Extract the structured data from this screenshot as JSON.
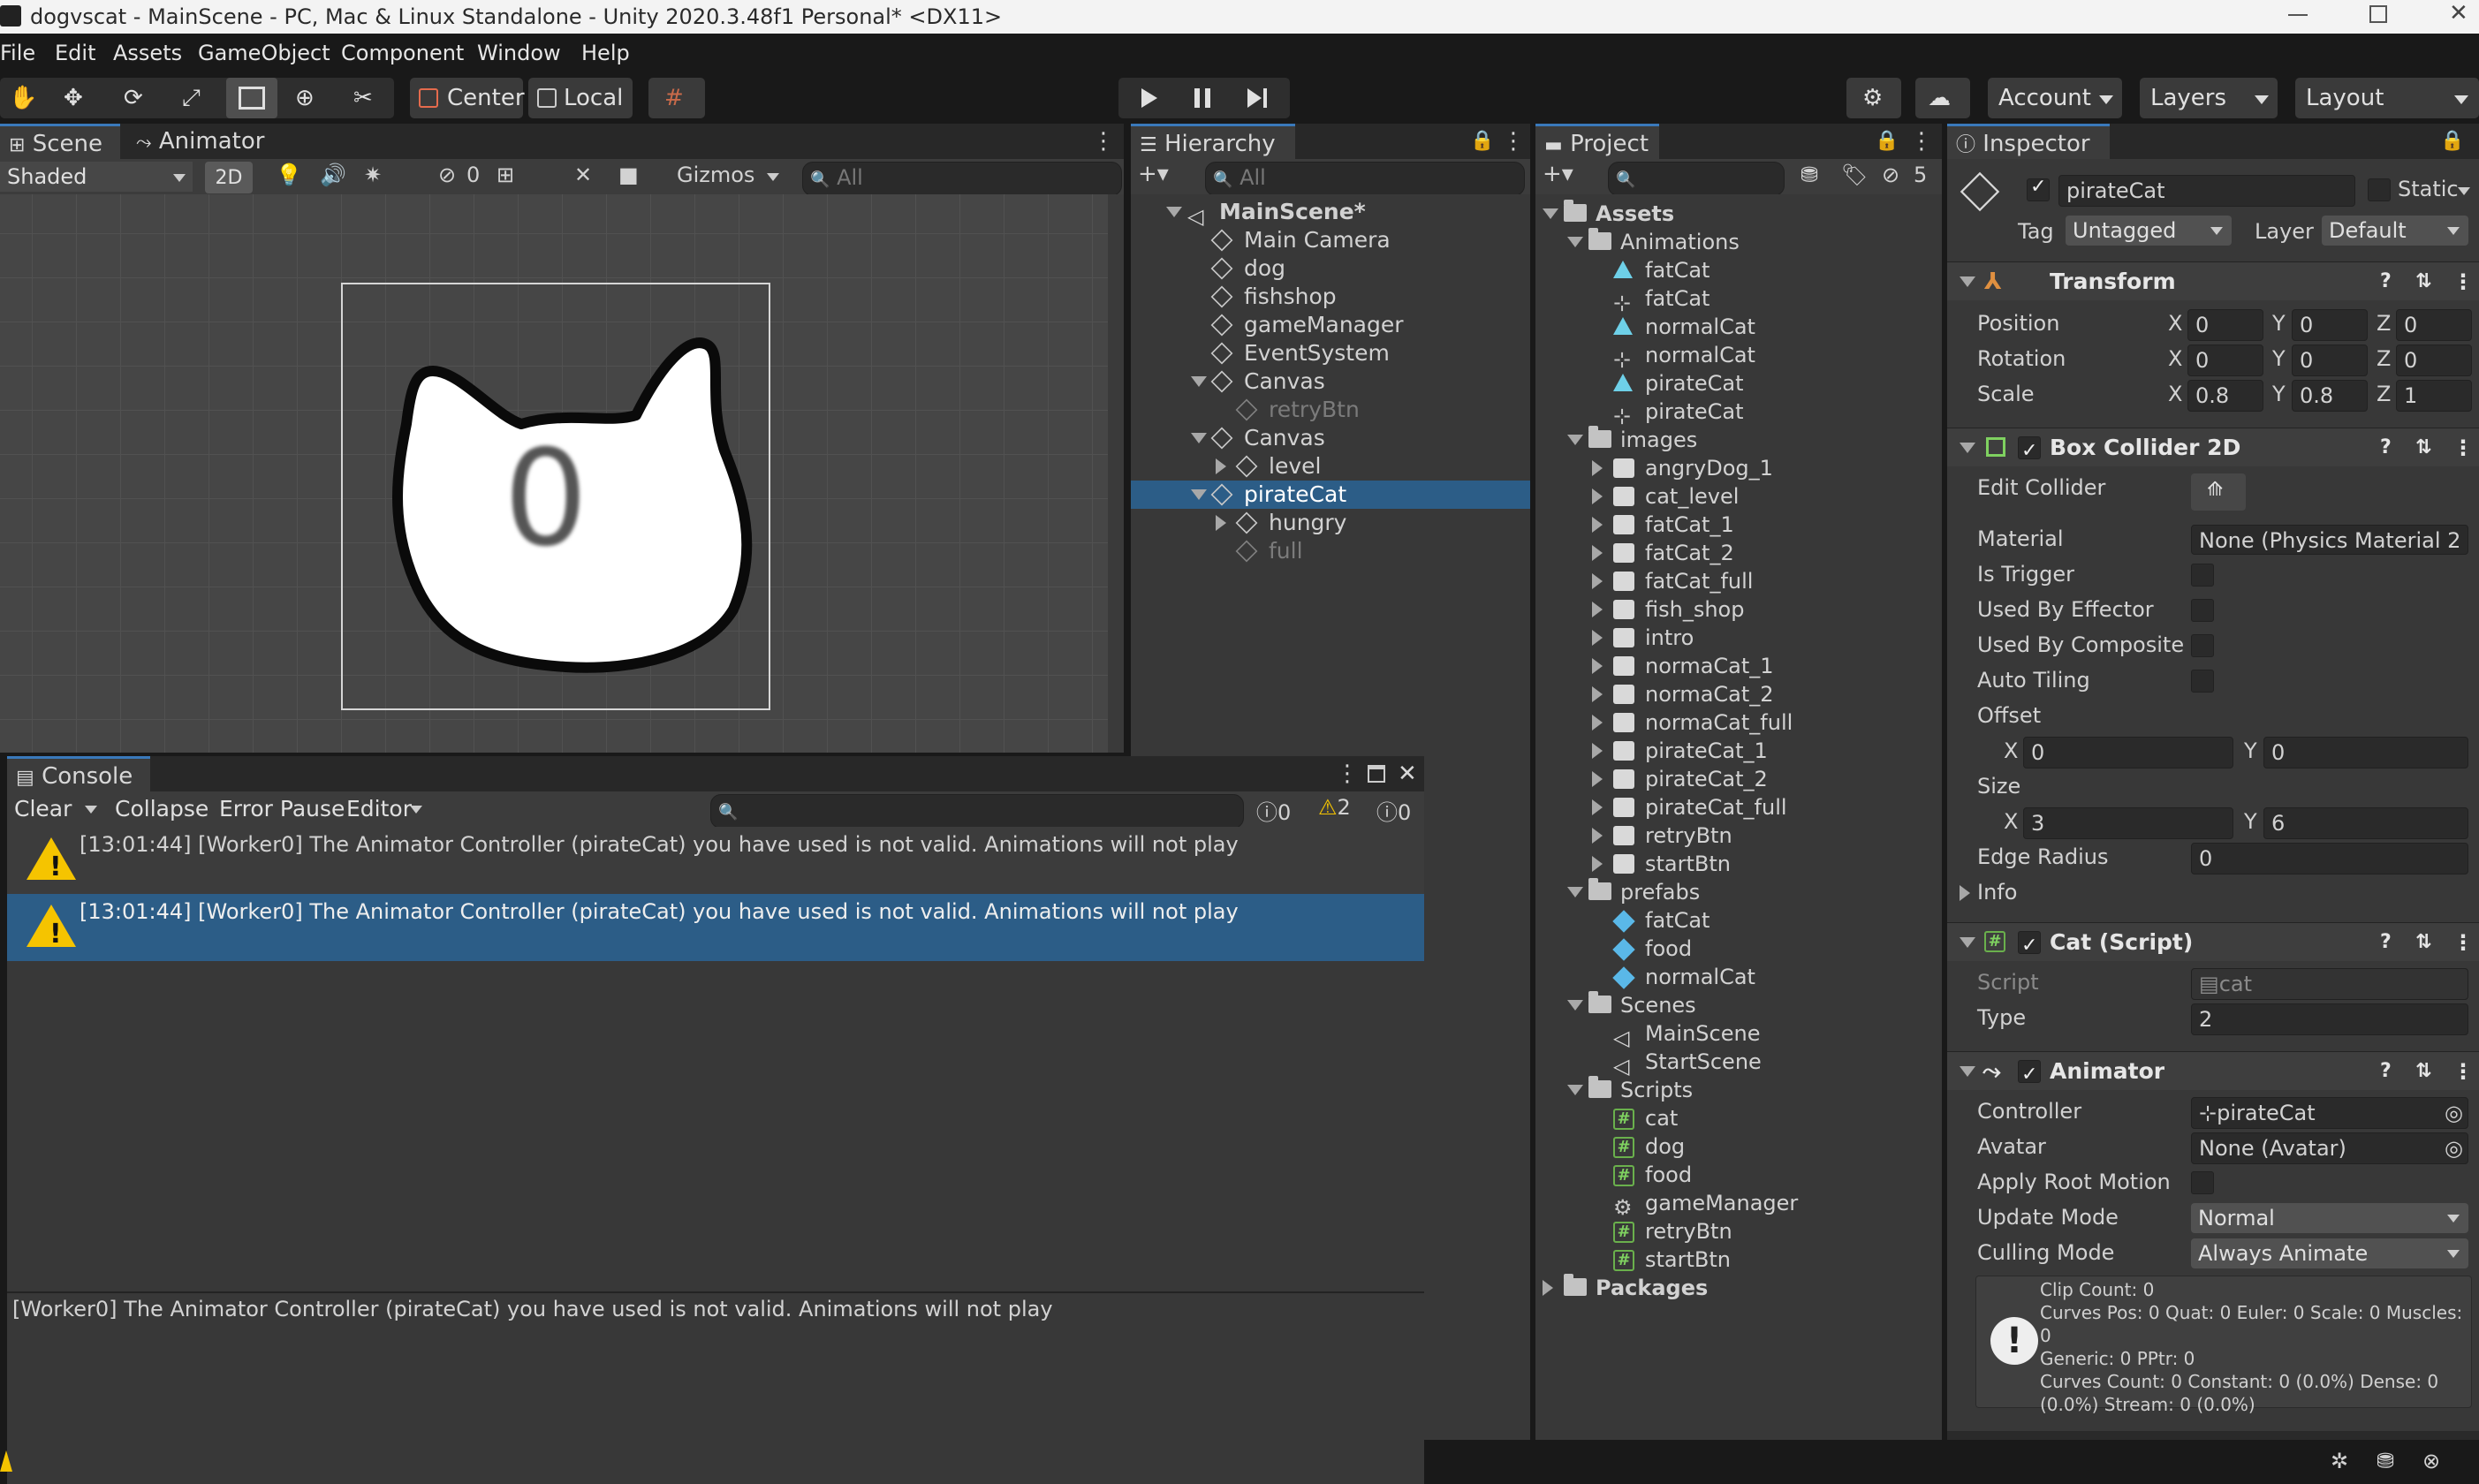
{
  "window": {
    "title": "dogvscat - MainScene - PC, Mac & Linux Standalone - Unity 2020.3.48f1 Personal* <DX11>"
  },
  "menu": [
    "File",
    "Edit",
    "Assets",
    "GameObject",
    "Component",
    "Window",
    "Help"
  ],
  "toolbar": {
    "center": "Center",
    "local": "Local",
    "account": "Account",
    "layers": "Layers",
    "layout": "Layout"
  },
  "scene": {
    "tab_scene": "Scene",
    "tab_animator": "Animator",
    "shading": "Shaded",
    "mode_2d": "2D",
    "hidden_count": "0",
    "gizmos": "Gizmos",
    "search_placeholder": "All",
    "cat_number": "0"
  },
  "hierarchy": {
    "tab": "Hierarchy",
    "search_placeholder": "All",
    "rows": [
      {
        "label": "MainScene*",
        "indent": 0,
        "icon": "scene",
        "expand": "open",
        "bold": true
      },
      {
        "label": "Main Camera",
        "indent": 1,
        "icon": "cube"
      },
      {
        "label": "dog",
        "indent": 1,
        "icon": "cube"
      },
      {
        "label": "fishshop",
        "indent": 1,
        "icon": "cube"
      },
      {
        "label": "gameManager",
        "indent": 1,
        "icon": "cube"
      },
      {
        "label": "EventSystem",
        "indent": 1,
        "icon": "cube"
      },
      {
        "label": "Canvas",
        "indent": 1,
        "icon": "cube",
        "expand": "open"
      },
      {
        "label": "retryBtn",
        "indent": 2,
        "icon": "cube",
        "dim": true
      },
      {
        "label": "Canvas",
        "indent": 1,
        "icon": "cube",
        "expand": "open"
      },
      {
        "label": "level",
        "indent": 2,
        "icon": "cube",
        "expand": "closed"
      },
      {
        "label": "pirateCat",
        "indent": 1,
        "icon": "cube",
        "expand": "open",
        "selected": true
      },
      {
        "label": "hungry",
        "indent": 2,
        "icon": "cube",
        "expand": "closed"
      },
      {
        "label": "full",
        "indent": 2,
        "icon": "cube",
        "dim": true
      }
    ]
  },
  "project": {
    "tab": "Project",
    "hidden_count": "5",
    "rows": [
      {
        "label": "Assets",
        "indent": 0,
        "icon": "folder",
        "expand": "open",
        "bold": true
      },
      {
        "label": "Animations",
        "indent": 1,
        "icon": "folder",
        "expand": "open"
      },
      {
        "label": "fatCat",
        "indent": 2,
        "icon": "anim"
      },
      {
        "label": "fatCat",
        "indent": 2,
        "icon": "ctrl"
      },
      {
        "label": "normalCat",
        "indent": 2,
        "icon": "anim"
      },
      {
        "label": "normalCat",
        "indent": 2,
        "icon": "ctrl"
      },
      {
        "label": "pirateCat",
        "indent": 2,
        "icon": "anim"
      },
      {
        "label": "pirateCat",
        "indent": 2,
        "icon": "ctrl"
      },
      {
        "label": "images",
        "indent": 1,
        "icon": "folder",
        "expand": "open"
      },
      {
        "label": "angryDog_1",
        "indent": 2,
        "icon": "img",
        "expand": "closed"
      },
      {
        "label": "cat_level",
        "indent": 2,
        "icon": "img",
        "expand": "closed"
      },
      {
        "label": "fatCat_1",
        "indent": 2,
        "icon": "img",
        "expand": "closed"
      },
      {
        "label": "fatCat_2",
        "indent": 2,
        "icon": "img",
        "expand": "closed"
      },
      {
        "label": "fatCat_full",
        "indent": 2,
        "icon": "img",
        "expand": "closed"
      },
      {
        "label": "fish_shop",
        "indent": 2,
        "icon": "img",
        "expand": "closed"
      },
      {
        "label": "intro",
        "indent": 2,
        "icon": "img",
        "expand": "closed"
      },
      {
        "label": "normaCat_1",
        "indent": 2,
        "icon": "img",
        "expand": "closed"
      },
      {
        "label": "normaCat_2",
        "indent": 2,
        "icon": "img",
        "expand": "closed"
      },
      {
        "label": "normaCat_full",
        "indent": 2,
        "icon": "img",
        "expand": "closed"
      },
      {
        "label": "pirateCat_1",
        "indent": 2,
        "icon": "img",
        "expand": "closed"
      },
      {
        "label": "pirateCat_2",
        "indent": 2,
        "icon": "img",
        "expand": "closed"
      },
      {
        "label": "pirateCat_full",
        "indent": 2,
        "icon": "img",
        "expand": "closed"
      },
      {
        "label": "retryBtn",
        "indent": 2,
        "icon": "img",
        "expand": "closed"
      },
      {
        "label": "startBtn",
        "indent": 2,
        "icon": "img",
        "expand": "closed"
      },
      {
        "label": "prefabs",
        "indent": 1,
        "icon": "folder",
        "expand": "open"
      },
      {
        "label": "fatCat",
        "indent": 2,
        "icon": "prefab"
      },
      {
        "label": "food",
        "indent": 2,
        "icon": "prefab"
      },
      {
        "label": "normalCat",
        "indent": 2,
        "icon": "prefab"
      },
      {
        "label": "Scenes",
        "indent": 1,
        "icon": "folder",
        "expand": "open"
      },
      {
        "label": "MainScene",
        "indent": 2,
        "icon": "scene"
      },
      {
        "label": "StartScene",
        "indent": 2,
        "icon": "scene"
      },
      {
        "label": "Scripts",
        "indent": 1,
        "icon": "folder",
        "expand": "open"
      },
      {
        "label": "cat",
        "indent": 2,
        "icon": "script"
      },
      {
        "label": "dog",
        "indent": 2,
        "icon": "script"
      },
      {
        "label": "food",
        "indent": 2,
        "icon": "script"
      },
      {
        "label": "gameManager",
        "indent": 2,
        "icon": "gear"
      },
      {
        "label": "retryBtn",
        "indent": 2,
        "icon": "script"
      },
      {
        "label": "startBtn",
        "indent": 2,
        "icon": "script"
      },
      {
        "label": "Packages",
        "indent": 0,
        "icon": "folder",
        "expand": "closed",
        "bold": true
      }
    ]
  },
  "inspector": {
    "tab": "Inspector",
    "object_name": "pirateCat",
    "static": "Static",
    "tag_label": "Tag",
    "tag": "Untagged",
    "layer_label": "Layer",
    "layer": "Default",
    "transform": {
      "title": "Transform",
      "position": "Position",
      "rotation": "Rotation",
      "scale": "Scale",
      "x": "X",
      "y": "Y",
      "z": "Z",
      "pos": [
        "0",
        "0",
        "0"
      ],
      "rot": [
        "0",
        "0",
        "0"
      ],
      "scl": [
        "0.8",
        "0.8",
        "1"
      ]
    },
    "box": {
      "title": "Box Collider 2D",
      "edit_collider": "Edit Collider",
      "material": "Material",
      "material_value": "None (Physics Material 2",
      "is_trigger": "Is Trigger",
      "used_by_effector": "Used By Effector",
      "used_by_composite": "Used By Composite",
      "auto_tiling": "Auto Tiling",
      "offset": "Offset",
      "size": "Size",
      "offset_x": "0",
      "offset_y": "0",
      "size_x": "3",
      "size_y": "6",
      "edge_radius": "Edge Radius",
      "edge_value": "0",
      "info": "Info"
    },
    "cat": {
      "title": "Cat (Script)",
      "script": "Script",
      "script_value": "cat",
      "type": "Type",
      "type_value": "2"
    },
    "animator": {
      "title": "Animator",
      "controller": "Controller",
      "controller_value": "pirateCat",
      "avatar": "Avatar",
      "avatar_value": "None (Avatar)",
      "apply_root": "Apply Root Motion",
      "update_mode": "Update Mode",
      "update_value": "Normal",
      "culling_mode": "Culling Mode",
      "culling_value": "Always Animate",
      "info_lines": [
        "Clip Count: 0",
        "Curves Pos: 0 Quat: 0 Euler: 0 Scale: 0 Muscles: 0",
        "Generic: 0 PPtr: 0",
        "Curves Count: 0 Constant: 0 (0.0%) Dense: 0",
        "(0.0%) Stream: 0 (0.0%)"
      ]
    }
  },
  "console": {
    "tab": "Console",
    "clear": "Clear",
    "collapse": "Collapse",
    "error_pause": "Error Pause",
    "editor": "Editor",
    "count_info": "0",
    "count_warn": "2",
    "count_error": "0",
    "messages": [
      "[13:01:44] [Worker0] The Animator Controller (pirateCat) you have used is not valid. Animations will not play",
      "[13:01:44] [Worker0] The Animator Controller (pirateCat) you have used is not valid. Animations will not play"
    ],
    "detail": "[Worker0] The Animator Controller (pirateCat) you have used is not valid. Animations will not play"
  },
  "colors": {
    "selection": "#2c5d87",
    "accent": "#3a79bb",
    "panel": "#383838",
    "warning": "#f5c400"
  }
}
